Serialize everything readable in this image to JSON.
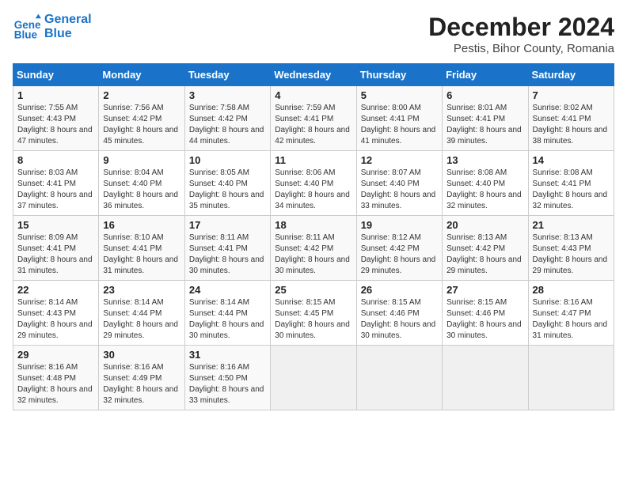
{
  "header": {
    "logo_line1": "General",
    "logo_line2": "Blue",
    "title": "December 2024",
    "subtitle": "Pestis, Bihor County, Romania"
  },
  "calendar": {
    "days": [
      "Sunday",
      "Monday",
      "Tuesday",
      "Wednesday",
      "Thursday",
      "Friday",
      "Saturday"
    ],
    "weeks": [
      [
        {
          "num": "1",
          "sunrise": "7:55 AM",
          "sunset": "4:43 PM",
          "daylight": "8 hours and 47 minutes."
        },
        {
          "num": "2",
          "sunrise": "7:56 AM",
          "sunset": "4:42 PM",
          "daylight": "8 hours and 45 minutes."
        },
        {
          "num": "3",
          "sunrise": "7:58 AM",
          "sunset": "4:42 PM",
          "daylight": "8 hours and 44 minutes."
        },
        {
          "num": "4",
          "sunrise": "7:59 AM",
          "sunset": "4:41 PM",
          "daylight": "8 hours and 42 minutes."
        },
        {
          "num": "5",
          "sunrise": "8:00 AM",
          "sunset": "4:41 PM",
          "daylight": "8 hours and 41 minutes."
        },
        {
          "num": "6",
          "sunrise": "8:01 AM",
          "sunset": "4:41 PM",
          "daylight": "8 hours and 39 minutes."
        },
        {
          "num": "7",
          "sunrise": "8:02 AM",
          "sunset": "4:41 PM",
          "daylight": "8 hours and 38 minutes."
        }
      ],
      [
        {
          "num": "8",
          "sunrise": "8:03 AM",
          "sunset": "4:41 PM",
          "daylight": "8 hours and 37 minutes."
        },
        {
          "num": "9",
          "sunrise": "8:04 AM",
          "sunset": "4:40 PM",
          "daylight": "8 hours and 36 minutes."
        },
        {
          "num": "10",
          "sunrise": "8:05 AM",
          "sunset": "4:40 PM",
          "daylight": "8 hours and 35 minutes."
        },
        {
          "num": "11",
          "sunrise": "8:06 AM",
          "sunset": "4:40 PM",
          "daylight": "8 hours and 34 minutes."
        },
        {
          "num": "12",
          "sunrise": "8:07 AM",
          "sunset": "4:40 PM",
          "daylight": "8 hours and 33 minutes."
        },
        {
          "num": "13",
          "sunrise": "8:08 AM",
          "sunset": "4:40 PM",
          "daylight": "8 hours and 32 minutes."
        },
        {
          "num": "14",
          "sunrise": "8:08 AM",
          "sunset": "4:41 PM",
          "daylight": "8 hours and 32 minutes."
        }
      ],
      [
        {
          "num": "15",
          "sunrise": "8:09 AM",
          "sunset": "4:41 PM",
          "daylight": "8 hours and 31 minutes."
        },
        {
          "num": "16",
          "sunrise": "8:10 AM",
          "sunset": "4:41 PM",
          "daylight": "8 hours and 31 minutes."
        },
        {
          "num": "17",
          "sunrise": "8:11 AM",
          "sunset": "4:41 PM",
          "daylight": "8 hours and 30 minutes."
        },
        {
          "num": "18",
          "sunrise": "8:11 AM",
          "sunset": "4:42 PM",
          "daylight": "8 hours and 30 minutes."
        },
        {
          "num": "19",
          "sunrise": "8:12 AM",
          "sunset": "4:42 PM",
          "daylight": "8 hours and 29 minutes."
        },
        {
          "num": "20",
          "sunrise": "8:13 AM",
          "sunset": "4:42 PM",
          "daylight": "8 hours and 29 minutes."
        },
        {
          "num": "21",
          "sunrise": "8:13 AM",
          "sunset": "4:43 PM",
          "daylight": "8 hours and 29 minutes."
        }
      ],
      [
        {
          "num": "22",
          "sunrise": "8:14 AM",
          "sunset": "4:43 PM",
          "daylight": "8 hours and 29 minutes."
        },
        {
          "num": "23",
          "sunrise": "8:14 AM",
          "sunset": "4:44 PM",
          "daylight": "8 hours and 29 minutes."
        },
        {
          "num": "24",
          "sunrise": "8:14 AM",
          "sunset": "4:44 PM",
          "daylight": "8 hours and 30 minutes."
        },
        {
          "num": "25",
          "sunrise": "8:15 AM",
          "sunset": "4:45 PM",
          "daylight": "8 hours and 30 minutes."
        },
        {
          "num": "26",
          "sunrise": "8:15 AM",
          "sunset": "4:46 PM",
          "daylight": "8 hours and 30 minutes."
        },
        {
          "num": "27",
          "sunrise": "8:15 AM",
          "sunset": "4:46 PM",
          "daylight": "8 hours and 30 minutes."
        },
        {
          "num": "28",
          "sunrise": "8:16 AM",
          "sunset": "4:47 PM",
          "daylight": "8 hours and 31 minutes."
        }
      ],
      [
        {
          "num": "29",
          "sunrise": "8:16 AM",
          "sunset": "4:48 PM",
          "daylight": "8 hours and 32 minutes."
        },
        {
          "num": "30",
          "sunrise": "8:16 AM",
          "sunset": "4:49 PM",
          "daylight": "8 hours and 32 minutes."
        },
        {
          "num": "31",
          "sunrise": "8:16 AM",
          "sunset": "4:50 PM",
          "daylight": "8 hours and 33 minutes."
        },
        null,
        null,
        null,
        null
      ]
    ]
  }
}
